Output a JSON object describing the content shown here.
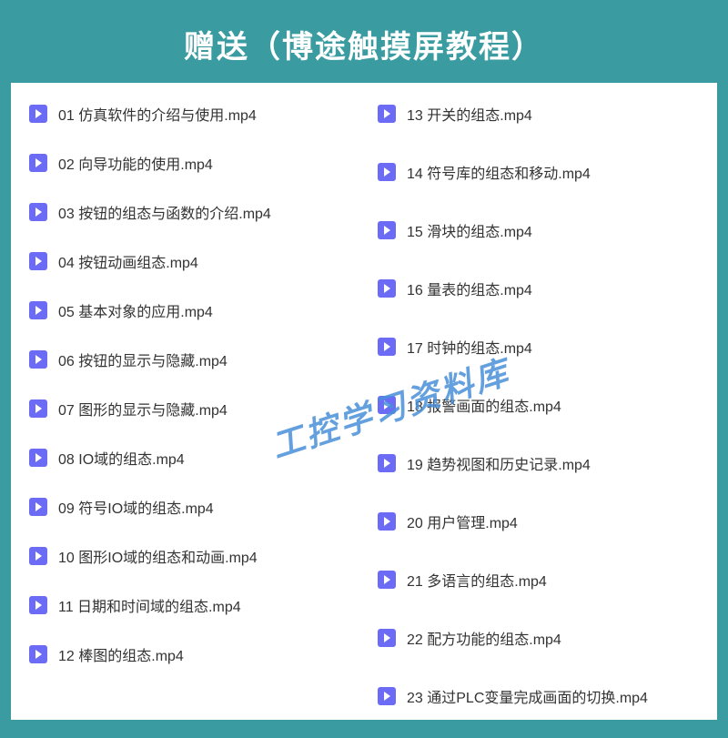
{
  "header": {
    "title": "赠送（博途触摸屏教程）"
  },
  "watermark": "工控学习资料库",
  "files": {
    "left": [
      "01 仿真软件的介绍与使用.mp4",
      "02 向导功能的使用.mp4",
      "03 按钮的组态与函数的介绍.mp4",
      "04 按钮动画组态.mp4",
      "05 基本对象的应用.mp4",
      "06 按钮的显示与隐藏.mp4",
      "07 图形的显示与隐藏.mp4",
      "08 IO域的组态.mp4",
      "09 符号IO域的组态.mp4",
      "10 图形IO域的组态和动画.mp4",
      "11 日期和时间域的组态.mp4",
      "12 棒图的组态.mp4"
    ],
    "right": [
      "13 开关的组态.mp4",
      "14 符号库的组态和移动.mp4",
      "15 滑块的组态.mp4",
      "16 量表的组态.mp4",
      "17 时钟的组态.mp4",
      "18 报警画面的组态.mp4",
      "19 趋势视图和历史记录.mp4",
      "20 用户管理.mp4",
      "21 多语言的组态.mp4",
      "22 配方功能的组态.mp4",
      "23 通过PLC变量完成画面的切换.mp4"
    ]
  }
}
